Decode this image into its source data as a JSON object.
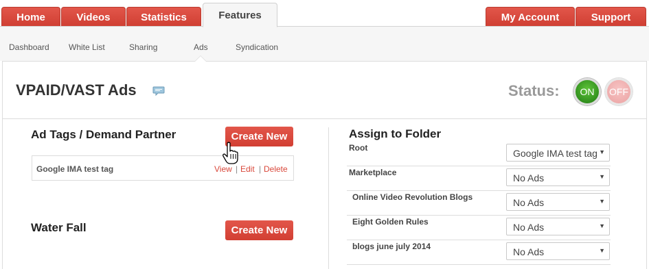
{
  "nav": {
    "tabs": [
      {
        "label": "Home"
      },
      {
        "label": "Videos"
      },
      {
        "label": "Statistics"
      },
      {
        "label": "Features"
      }
    ],
    "right_tabs": [
      {
        "label": "My Account"
      },
      {
        "label": "Support"
      }
    ],
    "active_tab": "Features"
  },
  "subnav": {
    "items": [
      {
        "label": "Dashboard"
      },
      {
        "label": "White List"
      },
      {
        "label": "Sharing"
      },
      {
        "label": "Ads"
      },
      {
        "label": "Syndication"
      }
    ],
    "active": "Ads"
  },
  "header": {
    "title": "VPAID/VAST Ads",
    "comment_icon": "speech-bubble-icon",
    "status_label": "Status:",
    "on_label": "ON",
    "off_label": "OFF",
    "status": "ON"
  },
  "ad_tags": {
    "title": "Ad Tags / Demand Partner",
    "create_label": "Create New",
    "rows": [
      {
        "name": "Google IMA test tag",
        "view": "View",
        "edit": "Edit",
        "delete": "Delete",
        "sep": "|"
      }
    ]
  },
  "waterfall": {
    "title": "Water Fall",
    "create_label": "Create New"
  },
  "assign": {
    "title": "Assign to Folder",
    "folders": [
      {
        "name": "Root",
        "value": "Google IMA test tag"
      },
      {
        "name": "Marketplace",
        "value": "No Ads"
      },
      {
        "name": "Online Video Revolution Blogs",
        "value": "No Ads"
      },
      {
        "name": "Eight Golden Rules",
        "value": "No Ads"
      },
      {
        "name": "blogs june july 2014",
        "value": "No Ads"
      }
    ]
  },
  "colors": {
    "accent": "#d9473a",
    "on_green": "#2e9a1c",
    "off_pink": "#eba2a2"
  }
}
